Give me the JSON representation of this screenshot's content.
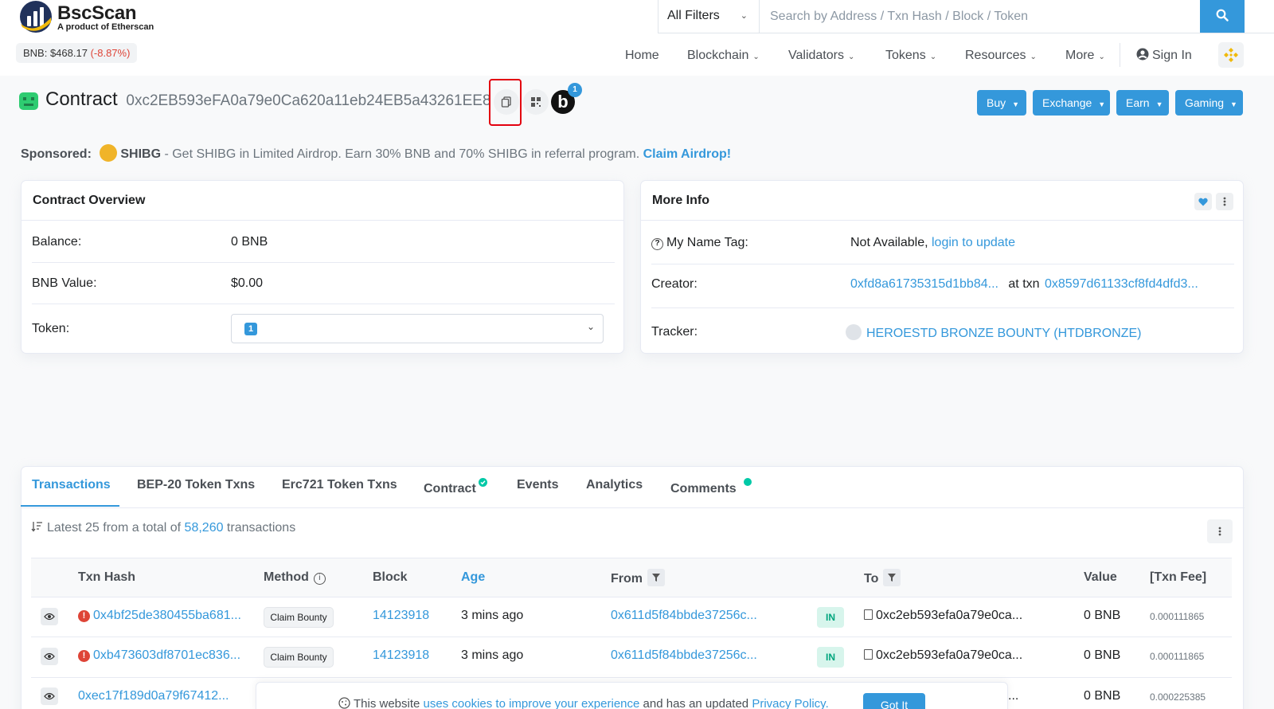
{
  "brand": {
    "name": "BscScan",
    "tagline": "A product of Etherscan",
    "price_label": "BNB: $468.17",
    "price_change": "(-8.87%)"
  },
  "search": {
    "filter_label": "All Filters",
    "placeholder": "Search by Address / Txn Hash / Block / Token"
  },
  "nav": {
    "home": "Home",
    "blockchain": "Blockchain",
    "validators": "Validators",
    "tokens": "Tokens",
    "resources": "Resources",
    "more": "More",
    "sign_in": "Sign In"
  },
  "contract": {
    "title": "Contract",
    "address": "0xc2EB593eFA0a79e0Ca620a11eb24EB5a43261EE8",
    "badge_letter": "b",
    "badge_count": "1"
  },
  "actions": [
    "Buy",
    "Exchange",
    "Earn",
    "Gaming"
  ],
  "sponsored": {
    "label": "Sponsored:",
    "brand": "SHIBG",
    "text": " - Get SHIBG in Limited Airdrop. Earn 30% BNB and 70% SHIBG in referral program. ",
    "link": "Claim Airdrop!"
  },
  "overview": {
    "title": "Contract Overview",
    "balance_label": "Balance:",
    "balance_value": "0 BNB",
    "bnb_value_label": "BNB Value:",
    "bnb_value": "$0.00",
    "token_label": "Token:",
    "token_count": "1"
  },
  "more_info": {
    "title": "More Info",
    "name_tag_label": "My Name Tag:",
    "name_tag_value": "Not Available, ",
    "name_tag_link": "login to update",
    "creator_label": "Creator:",
    "creator_address": "0xfd8a61735315d1bb84...",
    "creator_at": "at txn",
    "creator_txn": "0x8597d61133cf8fd4dfd3...",
    "tracker_label": "Tracker:",
    "tracker_value": "HEROESTD BRONZE BOUNTY (HTDBRONZE)"
  },
  "tabs": [
    "Transactions",
    "BEP-20 Token Txns",
    "Erc721 Token Txns",
    "Contract",
    "Events",
    "Analytics",
    "Comments"
  ],
  "summary": {
    "prefix": "Latest 25 from a total of ",
    "count": "58,260",
    "suffix": " transactions"
  },
  "table": {
    "headers": {
      "txn_hash": "Txn Hash",
      "method": "Method",
      "block": "Block",
      "age": "Age",
      "from": "From",
      "to": "To",
      "value": "Value",
      "fee": "[Txn Fee]"
    },
    "rows": [
      {
        "hash": "0x4bf25de380455ba681...",
        "method": "Claim Bounty",
        "block": "14123918",
        "age": "3 mins ago",
        "from": "0x611d5f84bbde37256c...",
        "direction": "IN",
        "to": "0xc2eb593efa0a79e0ca...",
        "value": "0 BNB",
        "fee": "0.000111865"
      },
      {
        "hash": "0xb473603df8701ec836...",
        "method": "Claim Bounty",
        "block": "14123918",
        "age": "3 mins ago",
        "from": "0x611d5f84bbde37256c...",
        "direction": "IN",
        "to": "0xc2eb593efa0a79e0ca...",
        "value": "0 BNB",
        "fee": "0.000111865"
      },
      {
        "hash": "0xec17f189d0a79f67412...",
        "to": "...",
        "value": "0 BNB",
        "fee": "0.000225385"
      }
    ]
  },
  "cookie": {
    "prefix": "This website ",
    "link1": "uses cookies to improve your experience",
    "middle": " and has an updated ",
    "link2": "Privacy Policy.",
    "button": "Got It"
  },
  "colors": {
    "accent": "#3498db",
    "negative": "#de4437",
    "success": "#00c9a7",
    "highlight": "#e3000f"
  }
}
